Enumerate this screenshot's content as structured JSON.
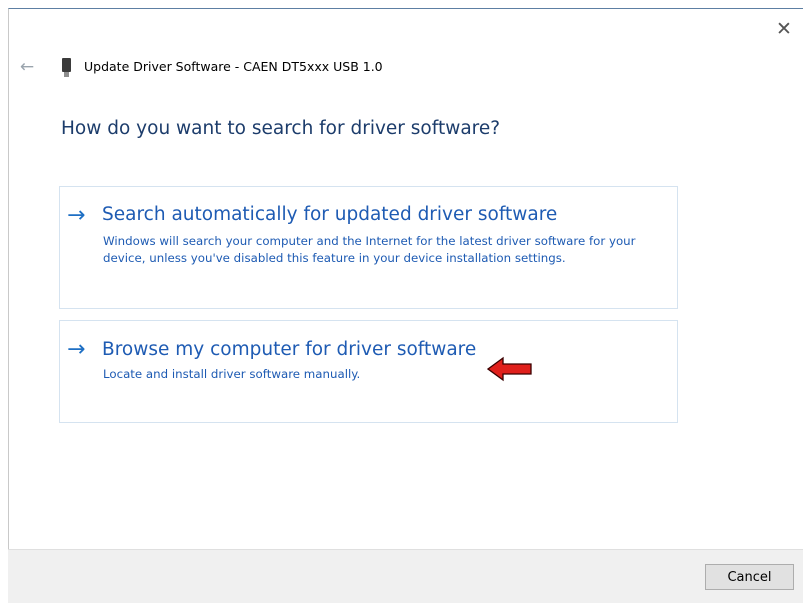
{
  "window": {
    "title": "Update Driver Software - CAEN DT5xxx USB 1.0",
    "close_glyph": "✕",
    "back_glyph": "←"
  },
  "main": {
    "heading": "How do you want to search for driver software?",
    "options": [
      {
        "title": "Search automatically for updated driver software",
        "description": "Windows will search your computer and the Internet for the latest driver software for your device, unless you've disabled this feature in your device installation settings.",
        "icon": "arrow-right-icon"
      },
      {
        "title": "Browse my computer for driver software",
        "description": "Locate and install driver software manually.",
        "icon": "arrow-right-icon"
      }
    ]
  },
  "footer": {
    "cancel_label": "Cancel"
  },
  "colors": {
    "link_blue": "#1e5bb3",
    "heading_blue": "#1c3c6b",
    "annotation_red": "#e0201c"
  }
}
